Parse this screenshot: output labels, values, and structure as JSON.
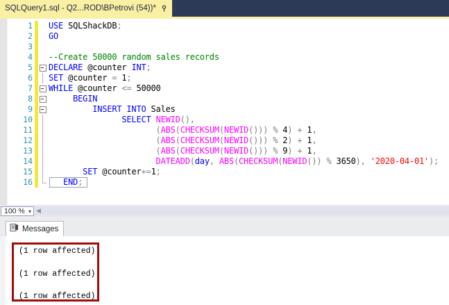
{
  "tab": {
    "title": "SQLQuery1.sql - Q2...ROD\\BPetrovi (54))*"
  },
  "editor": {
    "lines": [
      {
        "n": "1",
        "o": "",
        "t": [
          [
            "kw",
            "USE"
          ],
          [
            "pl",
            " SQLShackDB"
          ],
          [
            "op",
            ";"
          ]
        ]
      },
      {
        "n": "2",
        "o": "",
        "t": [
          [
            "kw",
            "GO"
          ]
        ]
      },
      {
        "n": "3",
        "o": "",
        "t": []
      },
      {
        "n": "4",
        "o": "",
        "t": [
          [
            "cm",
            "--Create 50000 random sales records"
          ]
        ]
      },
      {
        "n": "5",
        "o": "box",
        "t": [
          [
            "kw",
            "DECLARE"
          ],
          [
            "pl",
            " @counter "
          ],
          [
            "kw",
            "INT"
          ],
          [
            "op",
            ";"
          ]
        ]
      },
      {
        "n": "6",
        "o": "line",
        "t": [
          [
            "kw",
            "SET"
          ],
          [
            "pl",
            " @counter "
          ],
          [
            "op",
            "="
          ],
          [
            "pl",
            " 1"
          ],
          [
            "op",
            ";"
          ]
        ]
      },
      {
        "n": "7",
        "o": "box",
        "t": [
          [
            "kw",
            "WHILE"
          ],
          [
            "pl",
            " @counter "
          ],
          [
            "op",
            "<="
          ],
          [
            "pl",
            " 50000"
          ]
        ]
      },
      {
        "n": "8",
        "o": "box",
        "t": [
          [
            "pl",
            "     "
          ],
          [
            "kw",
            "BEGIN"
          ]
        ]
      },
      {
        "n": "9",
        "o": "box",
        "t": [
          [
            "pl",
            "         "
          ],
          [
            "kw",
            "INSERT INTO"
          ],
          [
            "pl",
            " Sales"
          ]
        ]
      },
      {
        "n": "10",
        "o": "line",
        "t": [
          [
            "pl",
            "               "
          ],
          [
            "kw",
            "SELECT"
          ],
          [
            "pl",
            " "
          ],
          [
            "fn",
            "NEWID"
          ],
          [
            "op",
            "(),"
          ]
        ]
      },
      {
        "n": "11",
        "o": "line",
        "t": [
          [
            "pl",
            "                      "
          ],
          [
            "op",
            "("
          ],
          [
            "fn",
            "ABS"
          ],
          [
            "op",
            "("
          ],
          [
            "fn",
            "CHECKSUM"
          ],
          [
            "op",
            "("
          ],
          [
            "fn",
            "NEWID"
          ],
          [
            "op",
            "()))"
          ],
          [
            "pl",
            " "
          ],
          [
            "op",
            "%"
          ],
          [
            "pl",
            " 4"
          ],
          [
            "op",
            ")"
          ],
          [
            "pl",
            " "
          ],
          [
            "op",
            "+"
          ],
          [
            "pl",
            " 1"
          ],
          [
            "op",
            ","
          ]
        ]
      },
      {
        "n": "12",
        "o": "line",
        "t": [
          [
            "pl",
            "                      "
          ],
          [
            "op",
            "("
          ],
          [
            "fn",
            "ABS"
          ],
          [
            "op",
            "("
          ],
          [
            "fn",
            "CHECKSUM"
          ],
          [
            "op",
            "("
          ],
          [
            "fn",
            "NEWID"
          ],
          [
            "op",
            "()))"
          ],
          [
            "pl",
            " "
          ],
          [
            "op",
            "%"
          ],
          [
            "pl",
            " 2"
          ],
          [
            "op",
            ")"
          ],
          [
            "pl",
            " "
          ],
          [
            "op",
            "+"
          ],
          [
            "pl",
            " 1"
          ],
          [
            "op",
            ","
          ]
        ]
      },
      {
        "n": "13",
        "o": "line",
        "t": [
          [
            "pl",
            "                      "
          ],
          [
            "op",
            "("
          ],
          [
            "fn",
            "ABS"
          ],
          [
            "op",
            "("
          ],
          [
            "fn",
            "CHECKSUM"
          ],
          [
            "op",
            "("
          ],
          [
            "fn",
            "NEWID"
          ],
          [
            "op",
            "()))"
          ],
          [
            "pl",
            " "
          ],
          [
            "op",
            "%"
          ],
          [
            "pl",
            " 9"
          ],
          [
            "op",
            ")"
          ],
          [
            "pl",
            " "
          ],
          [
            "op",
            "+"
          ],
          [
            "pl",
            " 1"
          ],
          [
            "op",
            ","
          ]
        ]
      },
      {
        "n": "14",
        "o": "line",
        "t": [
          [
            "pl",
            "                      "
          ],
          [
            "fn",
            "DATEADD"
          ],
          [
            "op",
            "("
          ],
          [
            "kw",
            "day"
          ],
          [
            "op",
            ","
          ],
          [
            "pl",
            " "
          ],
          [
            "fn",
            "ABS"
          ],
          [
            "op",
            "("
          ],
          [
            "fn",
            "CHECKSUM"
          ],
          [
            "op",
            "("
          ],
          [
            "fn",
            "NEWID"
          ],
          [
            "op",
            "())"
          ],
          [
            "pl",
            " "
          ],
          [
            "op",
            "%"
          ],
          [
            "pl",
            " 3650"
          ],
          [
            "op",
            "),"
          ],
          [
            "pl",
            " "
          ],
          [
            "st",
            "'2020-04-01'"
          ],
          [
            "op",
            ");"
          ]
        ]
      },
      {
        "n": "15",
        "o": "line",
        "t": [
          [
            "pl",
            "       "
          ],
          [
            "kw",
            "SET"
          ],
          [
            "pl",
            " @counter"
          ],
          [
            "op",
            "+="
          ],
          [
            "pl",
            "1"
          ],
          [
            "op",
            ";"
          ]
        ]
      },
      {
        "n": "16",
        "o": "end",
        "box": true,
        "t": [
          [
            "pl",
            "   "
          ],
          [
            "kw",
            "END"
          ],
          [
            "op",
            ";"
          ]
        ]
      }
    ]
  },
  "statusbar": {
    "zoom": "100 %"
  },
  "results": {
    "tab_label": "Messages",
    "messages": [
      "(1 row affected)",
      "(1 row affected)",
      "(1 row affected)"
    ]
  },
  "colors": {
    "tabbar_navy": "#2C3A58",
    "active_tab_yellow": "#FAF0A3",
    "keyword_blue": "#0000FF",
    "function_magenta": "#FF00FF",
    "comment_green": "#008000",
    "string_red": "#FF0000",
    "operator_gray": "#808080",
    "line_number_teal": "#2B91AF",
    "change_bar_yellow": "#F3E73D",
    "annotation_red": "#A00B0B"
  }
}
